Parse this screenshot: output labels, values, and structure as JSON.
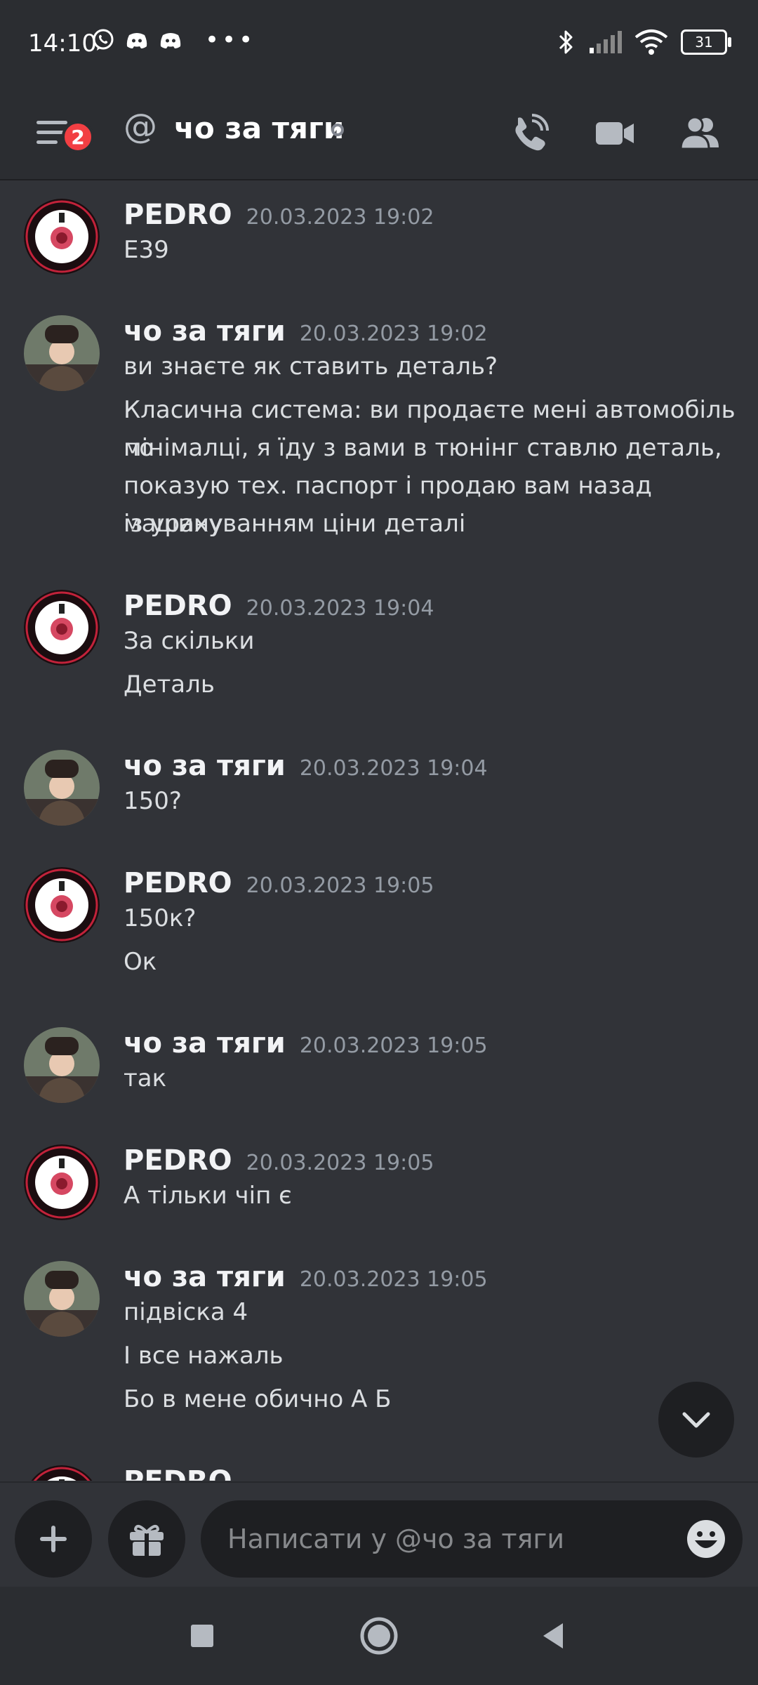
{
  "status_bar": {
    "time": "14:10",
    "battery": "31",
    "left_icons": [
      "viber-icon",
      "discord-icon",
      "discord-icon"
    ],
    "right_icons": [
      "bluetooth-icon",
      "signal-icon",
      "wifi-icon",
      "battery-icon"
    ]
  },
  "header": {
    "unread_badge": "2",
    "at_symbol": "@",
    "title": "чо за тяги",
    "icons": [
      "menu-icon",
      "call-icon",
      "video-call-icon",
      "members-icon"
    ]
  },
  "messages": [
    {
      "author": "PEDRO",
      "timestamp": "20.03.2023 19:02",
      "avatar": "pmc-logo",
      "lines": [
        "E39"
      ]
    },
    {
      "author": "чо за тяги",
      "timestamp": "20.03.2023 19:02",
      "avatar": "user-photo",
      "lines": [
        "ви знаєте як ставить деталь?",
        "Класична система: ви продаєте мені автомобіль по",
        "мінімалці, я їду з вами в тюнінг ставлю деталь,",
        "показую тех. паспорт і продаю вам назад машину",
        "із урахуванням ціни деталі"
      ]
    },
    {
      "author": "PEDRO",
      "timestamp": "20.03.2023 19:04",
      "avatar": "pmc-logo",
      "lines": [
        "За скільки",
        "Деталь"
      ]
    },
    {
      "author": "чо за тяги",
      "timestamp": "20.03.2023 19:04",
      "avatar": "user-photo",
      "lines": [
        "150?"
      ]
    },
    {
      "author": "PEDRO",
      "timestamp": "20.03.2023 19:05",
      "avatar": "pmc-logo",
      "lines": [
        "150к?",
        "Ок"
      ]
    },
    {
      "author": "чо за тяги",
      "timestamp": "20.03.2023 19:05",
      "avatar": "user-photo",
      "lines": [
        "так"
      ]
    },
    {
      "author": "PEDRO",
      "timestamp": "20.03.2023 19:05",
      "avatar": "pmc-logo",
      "lines": [
        "А тільки чіп є"
      ]
    },
    {
      "author": "чо за тяги",
      "timestamp": "20.03.2023 19:05",
      "avatar": "user-photo",
      "lines": [
        "підвіска 4",
        "І все нажаль",
        "Бо в мене обично А Б"
      ]
    },
    {
      "author": "PEDRO",
      "timestamp": "",
      "avatar": "pmc-logo",
      "lines": []
    }
  ],
  "composer": {
    "placeholder": "Написати у @чо за тяги",
    "icons": [
      "plus-icon",
      "gift-icon",
      "emoji-icon"
    ]
  },
  "scroll_button_icon": "chevron-down-icon",
  "nav_icons": [
    "recents-icon",
    "home-icon",
    "back-icon"
  ],
  "colors": {
    "background": "#313338",
    "header": "#2b2d31",
    "input": "#1e1f22",
    "badge": "#f23f43",
    "timestamp": "#949ba4"
  }
}
